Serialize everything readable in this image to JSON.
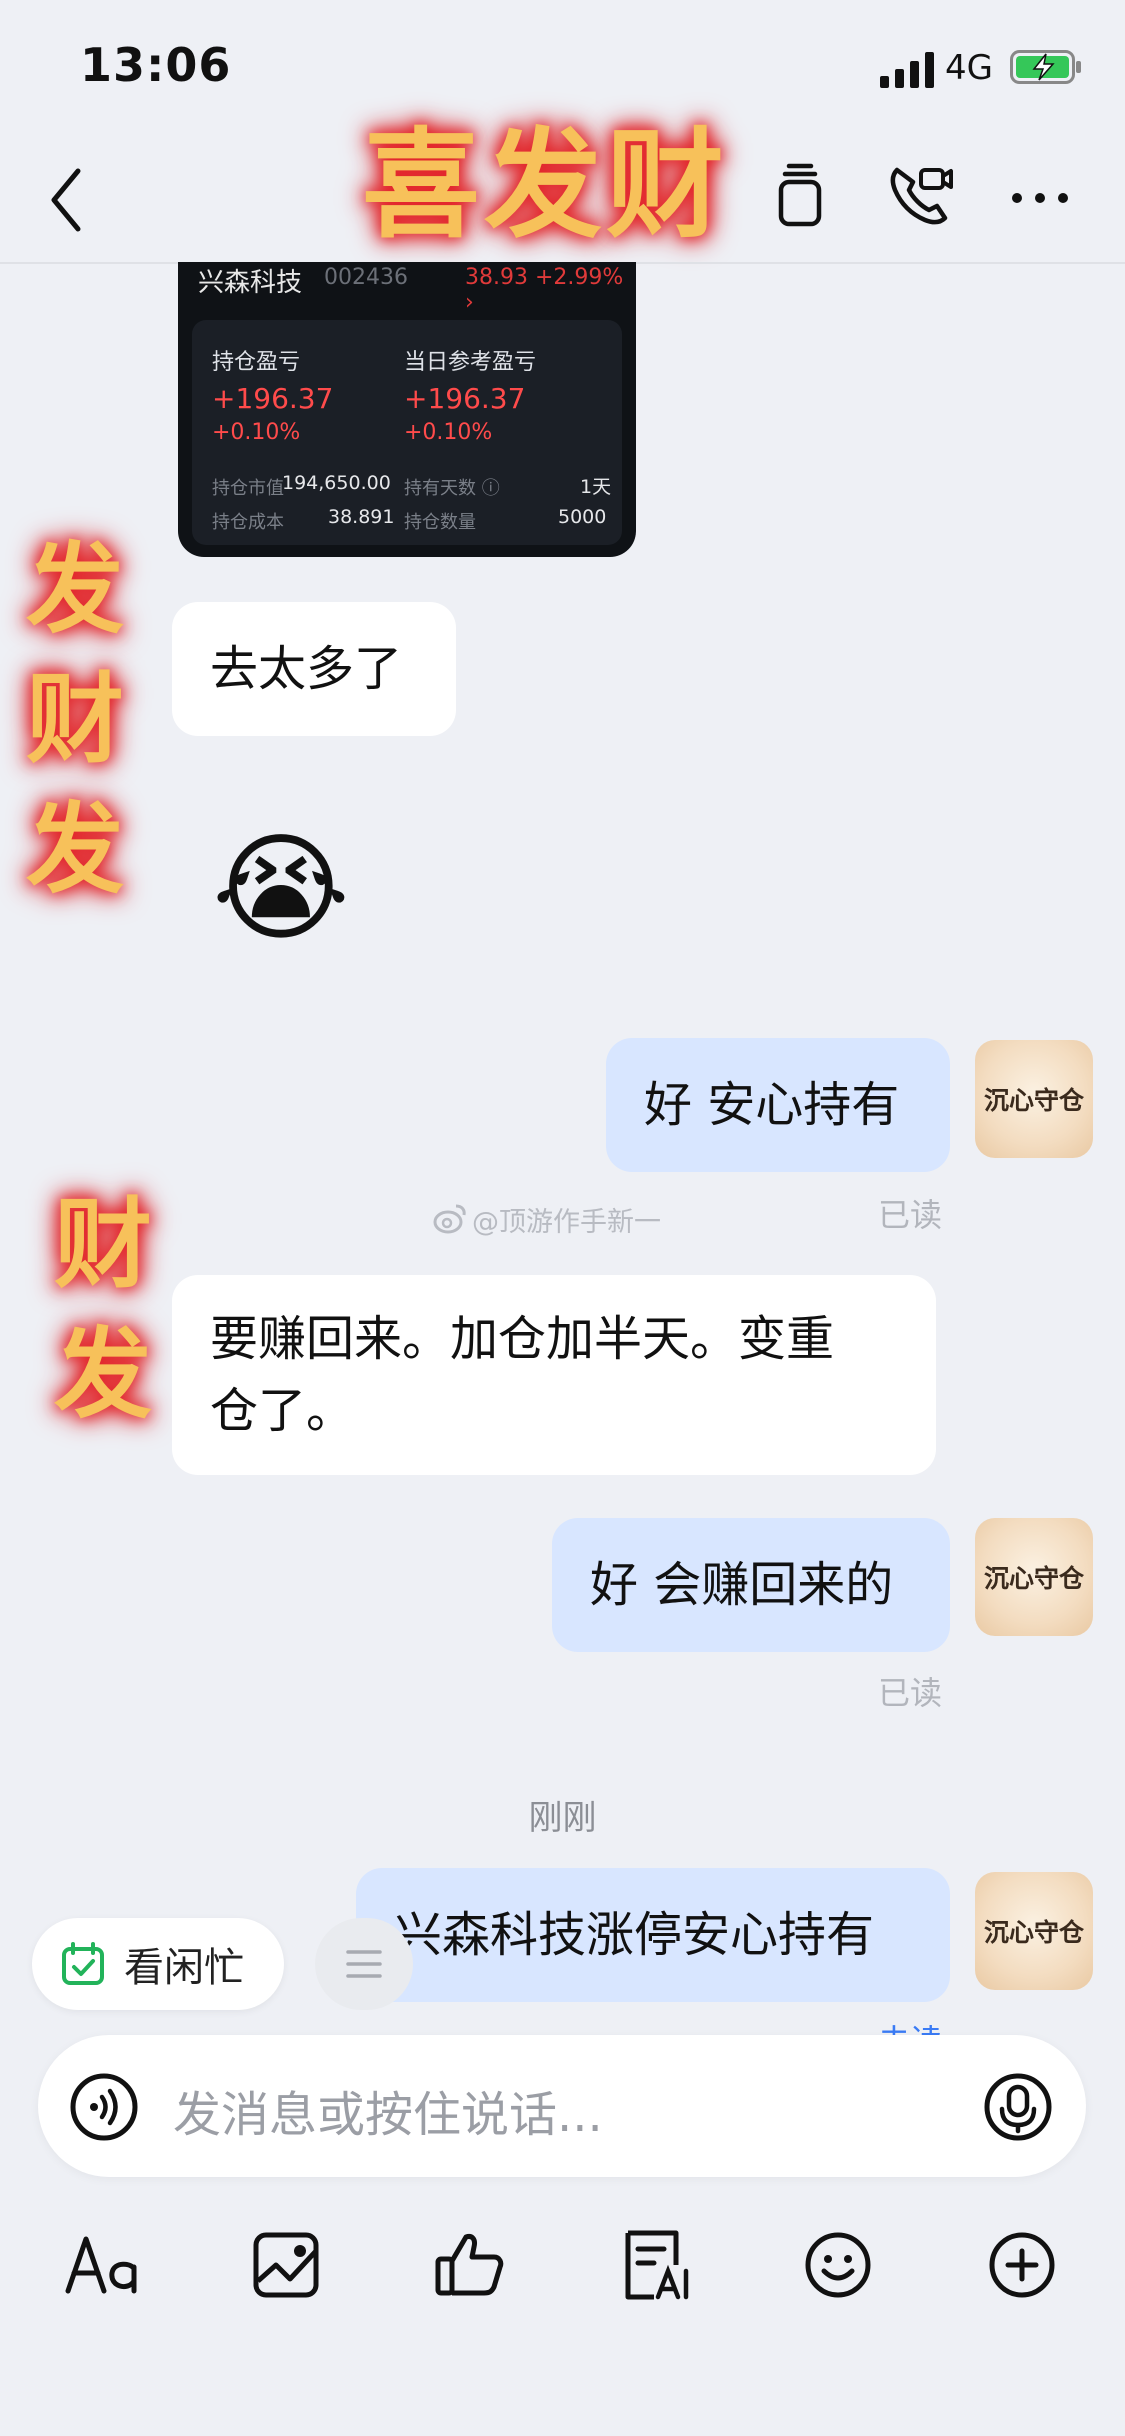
{
  "status_bar": {
    "time": "13:06",
    "network": "4G"
  },
  "header": {
    "sticker_text": "喜发财"
  },
  "stickers": {
    "left_top": "发财发",
    "left_bottom": "财发"
  },
  "stock_card": {
    "name": "兴森科技",
    "code": "002436",
    "quote": "38.93 +2.99% ›",
    "position_pnl_label": "持仓盈亏",
    "position_pnl_value": "+196.37",
    "position_pnl_pct": "+0.10%",
    "daily_pnl_label": "当日参考盈亏",
    "daily_pnl_value": "+196.37",
    "daily_pnl_pct": "+0.10%",
    "market_value_label": "持仓市值",
    "market_value": "194,650.00",
    "hold_days_label": "持有天数 ⓘ",
    "hold_days": "1天",
    "cost_label": "持仓成本",
    "cost": "38.891",
    "quantity_label": "持仓数量",
    "quantity": "5000"
  },
  "messages": {
    "m1": "去太多了",
    "m2_emoji": "😭",
    "m3": "好 安心持有",
    "m3_status": "已读",
    "m4_line1": "要赚回来。加仓加半天。变重",
    "m4_line2": "仓了。",
    "m5": "好 会赚回来的",
    "m5_status": "已读",
    "time_separator": "刚刚",
    "m6": "兴森科技涨停安心持有",
    "m6_status": "未读"
  },
  "avatar_text": "沉心守仓",
  "watermark": "@顶游作手新一",
  "quick_actions": {
    "busy_label": "看闲忙"
  },
  "input": {
    "placeholder": "发消息或按住说话..."
  },
  "colors": {
    "outgoing_bubble": "#d8e6ff",
    "profit_red": "#ff4b4b",
    "background": "#eef0f5"
  }
}
